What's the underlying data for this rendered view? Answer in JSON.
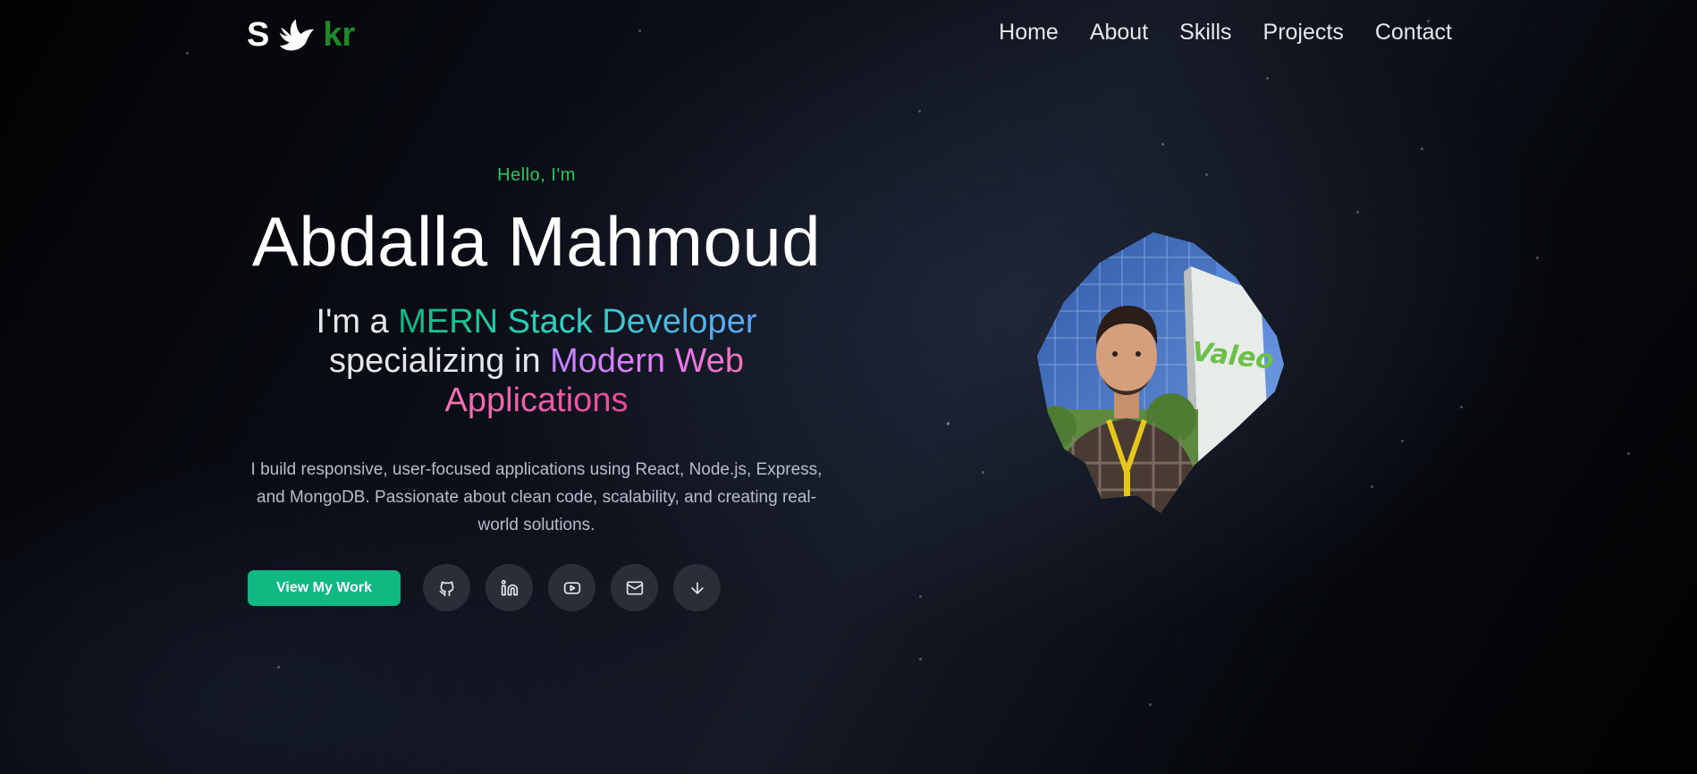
{
  "brand": {
    "letter_left": "S",
    "letters_right": "kr",
    "icon": "dove-icon",
    "colors": {
      "left": "#ffffff",
      "right": "#1f8a2a"
    }
  },
  "nav": {
    "items": [
      {
        "label": "Home"
      },
      {
        "label": "About"
      },
      {
        "label": "Skills"
      },
      {
        "label": "Projects"
      },
      {
        "label": "Contact"
      }
    ]
  },
  "hero": {
    "greeting": "Hello, I'm",
    "name": "Abdalla Mahmoud",
    "tagline": {
      "prefix": "I'm a ",
      "role": "MERN Stack Developer",
      "middle": "specializing in ",
      "focus_1": "Modern Web",
      "focus_2": "Applications"
    },
    "description": "I build responsive, user-focused applications using React, Node.js, Express, and MongoDB. Passionate about clean code, scalability, and creating real-world solutions."
  },
  "actions": {
    "primary_label": "View My Work",
    "icons": [
      "github-icon",
      "linkedin-icon",
      "youtube-icon",
      "mail-icon",
      "arrow-down-icon"
    ]
  },
  "photo": {
    "sign_text": "Valeo"
  },
  "colors": {
    "accent": "#10b981",
    "greeting": "#22c55e",
    "icon_bg": "#2a2e38"
  }
}
